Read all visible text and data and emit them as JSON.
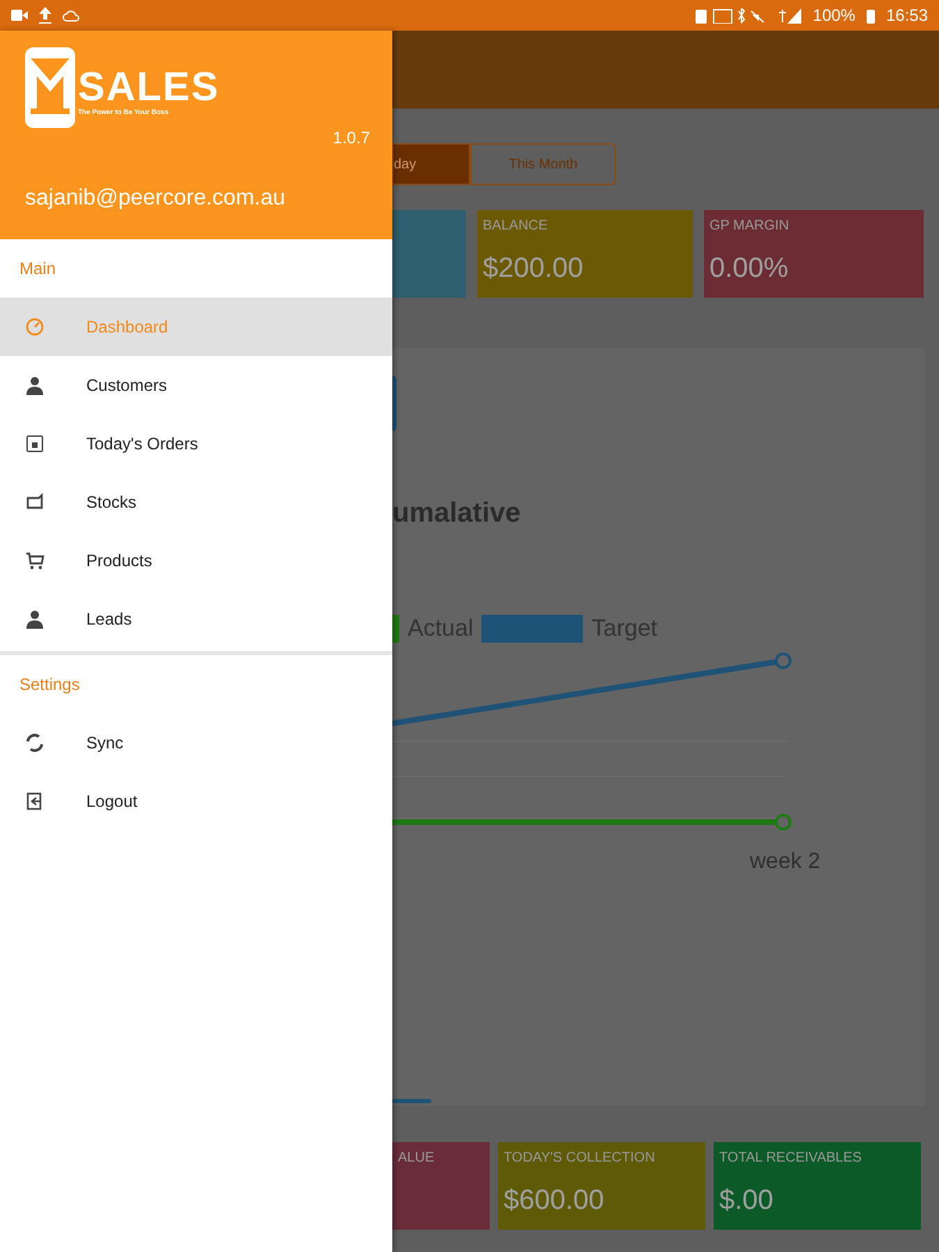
{
  "status_bar": {
    "battery": "100%",
    "time": "16:53"
  },
  "drawer": {
    "logo": {
      "name": "SALES",
      "tagline": "The Power to Be Your Boss"
    },
    "version": "1.0.7",
    "email": "sajanib@peercore.com.au",
    "sections": [
      {
        "title": "Main",
        "items": [
          {
            "label": "Dashboard",
            "selected": true
          },
          {
            "label": "Customers",
            "selected": false
          },
          {
            "label": "Today's Orders",
            "selected": false
          },
          {
            "label": "Stocks",
            "selected": false
          },
          {
            "label": "Products",
            "selected": false
          },
          {
            "label": "Leads",
            "selected": false
          }
        ]
      },
      {
        "title": "Settings",
        "items": [
          {
            "label": "Sync",
            "selected": false
          },
          {
            "label": "Logout",
            "selected": false
          }
        ]
      }
    ]
  },
  "dashboard": {
    "period_tabs": [
      {
        "label": "day",
        "selected": true
      },
      {
        "label": "This Month",
        "selected": false
      }
    ],
    "top_cards": [
      {
        "color": "#2d5f6f"
      },
      {
        "label": "BALANCE",
        "value": "$200.00",
        "color": "#6b5a03"
      },
      {
        "label": "GP MARGIN",
        "value": "0.00%",
        "color": "#6b2c33"
      }
    ],
    "chart": {
      "title": "umalative",
      "legend": [
        {
          "label": "Actual",
          "color": "#1f7a14"
        },
        {
          "label": "Target",
          "color": "#1e5277"
        }
      ],
      "x_label": "week 2"
    },
    "bottom_cards": [
      {
        "label": "ALUE",
        "color": "#6b2c3a"
      },
      {
        "label": "TODAY'S COLLECTION",
        "value": "$600.00",
        "color": "#5f5a08"
      },
      {
        "label": "TOTAL RECEIVABLES",
        "value": "$.00",
        "color": "#0b5a27"
      }
    ]
  }
}
